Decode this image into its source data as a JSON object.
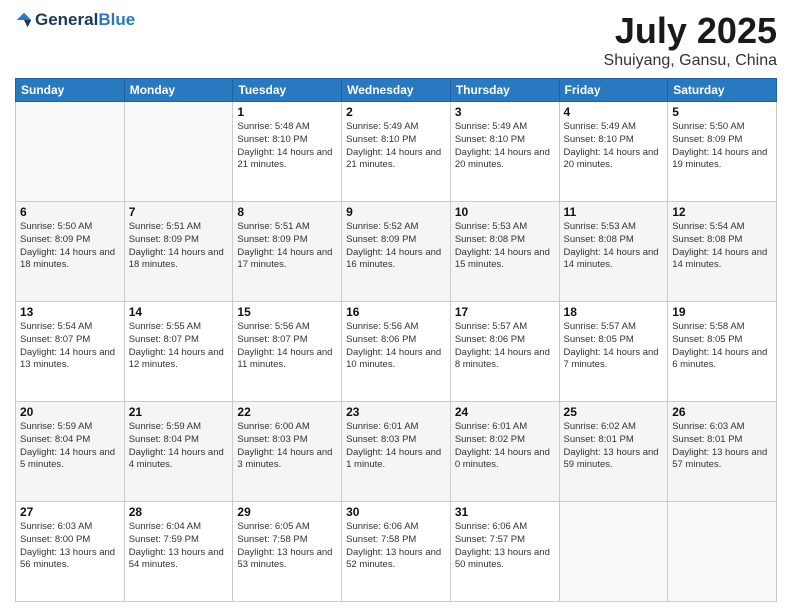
{
  "logo": {
    "general": "General",
    "blue": "Blue"
  },
  "title": {
    "month_year": "July 2025",
    "location": "Shuiyang, Gansu, China"
  },
  "days_of_week": [
    "Sunday",
    "Monday",
    "Tuesday",
    "Wednesday",
    "Thursday",
    "Friday",
    "Saturday"
  ],
  "weeks": [
    [
      {
        "day": "",
        "info": ""
      },
      {
        "day": "",
        "info": ""
      },
      {
        "day": "1",
        "info": "Sunrise: 5:48 AM\nSunset: 8:10 PM\nDaylight: 14 hours and 21 minutes."
      },
      {
        "day": "2",
        "info": "Sunrise: 5:49 AM\nSunset: 8:10 PM\nDaylight: 14 hours and 21 minutes."
      },
      {
        "day": "3",
        "info": "Sunrise: 5:49 AM\nSunset: 8:10 PM\nDaylight: 14 hours and 20 minutes."
      },
      {
        "day": "4",
        "info": "Sunrise: 5:49 AM\nSunset: 8:10 PM\nDaylight: 14 hours and 20 minutes."
      },
      {
        "day": "5",
        "info": "Sunrise: 5:50 AM\nSunset: 8:09 PM\nDaylight: 14 hours and 19 minutes."
      }
    ],
    [
      {
        "day": "6",
        "info": "Sunrise: 5:50 AM\nSunset: 8:09 PM\nDaylight: 14 hours and 18 minutes."
      },
      {
        "day": "7",
        "info": "Sunrise: 5:51 AM\nSunset: 8:09 PM\nDaylight: 14 hours and 18 minutes."
      },
      {
        "day": "8",
        "info": "Sunrise: 5:51 AM\nSunset: 8:09 PM\nDaylight: 14 hours and 17 minutes."
      },
      {
        "day": "9",
        "info": "Sunrise: 5:52 AM\nSunset: 8:09 PM\nDaylight: 14 hours and 16 minutes."
      },
      {
        "day": "10",
        "info": "Sunrise: 5:53 AM\nSunset: 8:08 PM\nDaylight: 14 hours and 15 minutes."
      },
      {
        "day": "11",
        "info": "Sunrise: 5:53 AM\nSunset: 8:08 PM\nDaylight: 14 hours and 14 minutes."
      },
      {
        "day": "12",
        "info": "Sunrise: 5:54 AM\nSunset: 8:08 PM\nDaylight: 14 hours and 14 minutes."
      }
    ],
    [
      {
        "day": "13",
        "info": "Sunrise: 5:54 AM\nSunset: 8:07 PM\nDaylight: 14 hours and 13 minutes."
      },
      {
        "day": "14",
        "info": "Sunrise: 5:55 AM\nSunset: 8:07 PM\nDaylight: 14 hours and 12 minutes."
      },
      {
        "day": "15",
        "info": "Sunrise: 5:56 AM\nSunset: 8:07 PM\nDaylight: 14 hours and 11 minutes."
      },
      {
        "day": "16",
        "info": "Sunrise: 5:56 AM\nSunset: 8:06 PM\nDaylight: 14 hours and 10 minutes."
      },
      {
        "day": "17",
        "info": "Sunrise: 5:57 AM\nSunset: 8:06 PM\nDaylight: 14 hours and 8 minutes."
      },
      {
        "day": "18",
        "info": "Sunrise: 5:57 AM\nSunset: 8:05 PM\nDaylight: 14 hours and 7 minutes."
      },
      {
        "day": "19",
        "info": "Sunrise: 5:58 AM\nSunset: 8:05 PM\nDaylight: 14 hours and 6 minutes."
      }
    ],
    [
      {
        "day": "20",
        "info": "Sunrise: 5:59 AM\nSunset: 8:04 PM\nDaylight: 14 hours and 5 minutes."
      },
      {
        "day": "21",
        "info": "Sunrise: 5:59 AM\nSunset: 8:04 PM\nDaylight: 14 hours and 4 minutes."
      },
      {
        "day": "22",
        "info": "Sunrise: 6:00 AM\nSunset: 8:03 PM\nDaylight: 14 hours and 3 minutes."
      },
      {
        "day": "23",
        "info": "Sunrise: 6:01 AM\nSunset: 8:03 PM\nDaylight: 14 hours and 1 minute."
      },
      {
        "day": "24",
        "info": "Sunrise: 6:01 AM\nSunset: 8:02 PM\nDaylight: 14 hours and 0 minutes."
      },
      {
        "day": "25",
        "info": "Sunrise: 6:02 AM\nSunset: 8:01 PM\nDaylight: 13 hours and 59 minutes."
      },
      {
        "day": "26",
        "info": "Sunrise: 6:03 AM\nSunset: 8:01 PM\nDaylight: 13 hours and 57 minutes."
      }
    ],
    [
      {
        "day": "27",
        "info": "Sunrise: 6:03 AM\nSunset: 8:00 PM\nDaylight: 13 hours and 56 minutes."
      },
      {
        "day": "28",
        "info": "Sunrise: 6:04 AM\nSunset: 7:59 PM\nDaylight: 13 hours and 54 minutes."
      },
      {
        "day": "29",
        "info": "Sunrise: 6:05 AM\nSunset: 7:58 PM\nDaylight: 13 hours and 53 minutes."
      },
      {
        "day": "30",
        "info": "Sunrise: 6:06 AM\nSunset: 7:58 PM\nDaylight: 13 hours and 52 minutes."
      },
      {
        "day": "31",
        "info": "Sunrise: 6:06 AM\nSunset: 7:57 PM\nDaylight: 13 hours and 50 minutes."
      },
      {
        "day": "",
        "info": ""
      },
      {
        "day": "",
        "info": ""
      }
    ]
  ]
}
